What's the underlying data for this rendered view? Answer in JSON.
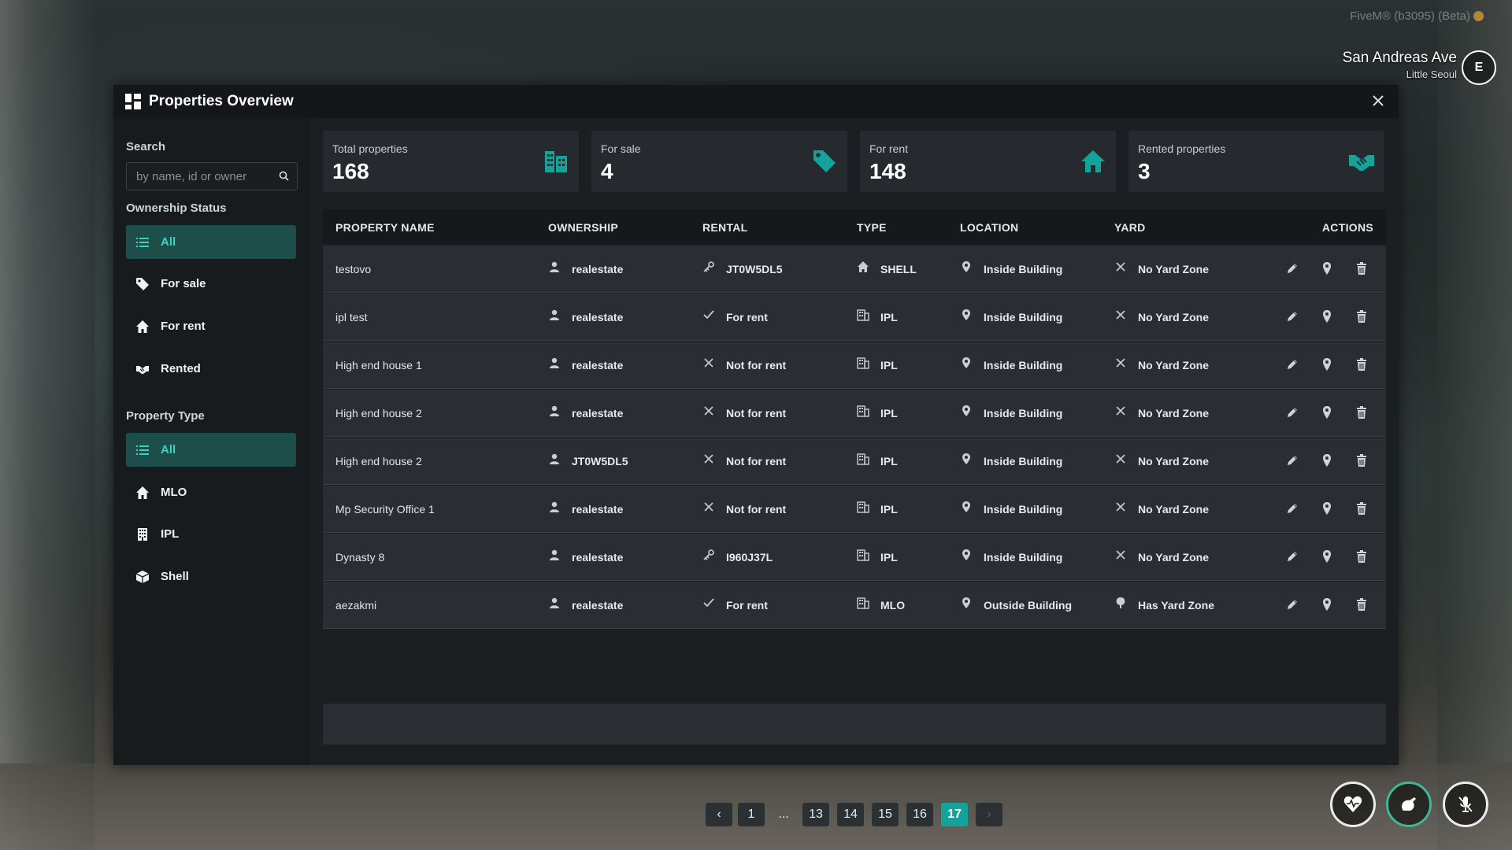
{
  "hud": {
    "fivem_label": "FiveM® (b3095) (Beta)",
    "street_name": "San Andreas Ave",
    "zone_name": "Little Seoul",
    "compass": "E"
  },
  "window": {
    "title": "Properties Overview",
    "close_icon": "close-icon"
  },
  "sidebar": {
    "search_label": "Search",
    "search_placeholder": "by name, id or owner",
    "ownership_label": "Ownership Status",
    "ownership_items": [
      {
        "label": "All",
        "icon": "list-icon",
        "active": true
      },
      {
        "label": "For sale",
        "icon": "tag-icon",
        "active": false
      },
      {
        "label": "For rent",
        "icon": "home-icon",
        "active": false
      },
      {
        "label": "Rented",
        "icon": "handshake-icon",
        "active": false
      }
    ],
    "type_label": "Property Type",
    "type_items": [
      {
        "label": "All",
        "icon": "list-icon",
        "active": true
      },
      {
        "label": "MLO",
        "icon": "home-icon",
        "active": false
      },
      {
        "label": "IPL",
        "icon": "building-icon",
        "active": false
      },
      {
        "label": "Shell",
        "icon": "cube-icon",
        "active": false
      }
    ]
  },
  "stats": [
    {
      "label": "Total properties",
      "value": "168",
      "icon": "building-icon"
    },
    {
      "label": "For sale",
      "value": "4",
      "icon": "tag-icon"
    },
    {
      "label": "For rent",
      "value": "148",
      "icon": "home-icon"
    },
    {
      "label": "Rented properties",
      "value": "3",
      "icon": "handshake-icon"
    }
  ],
  "table": {
    "headers": [
      "PROPERTY NAME",
      "OWNERSHIP",
      "RENTAL",
      "TYPE",
      "LOCATION",
      "YARD",
      "ACTIONS"
    ],
    "rows": [
      {
        "name": "testovo",
        "owner": "realestate",
        "rental": "JT0W5DL5",
        "rental_icon": "key-icon",
        "type": "SHELL",
        "type_icon": "home-icon",
        "location": "Inside Building",
        "yard": "No Yard Zone",
        "yard_icon": "x-icon"
      },
      {
        "name": "ipl test",
        "owner": "realestate",
        "rental": "For rent",
        "rental_icon": "check-icon",
        "type": "IPL",
        "type_icon": "building-icon",
        "location": "Inside Building",
        "yard": "No Yard Zone",
        "yard_icon": "x-icon"
      },
      {
        "name": "High end house 1",
        "owner": "realestate",
        "rental": "Not for rent",
        "rental_icon": "x-icon",
        "type": "IPL",
        "type_icon": "building-icon",
        "location": "Inside Building",
        "yard": "No Yard Zone",
        "yard_icon": "x-icon"
      },
      {
        "name": "High end house 2",
        "owner": "realestate",
        "rental": "Not for rent",
        "rental_icon": "x-icon",
        "type": "IPL",
        "type_icon": "building-icon",
        "location": "Inside Building",
        "yard": "No Yard Zone",
        "yard_icon": "x-icon"
      },
      {
        "name": "High end house 2",
        "owner": "JT0W5DL5",
        "rental": "Not for rent",
        "rental_icon": "x-icon",
        "type": "IPL",
        "type_icon": "building-icon",
        "location": "Inside Building",
        "yard": "No Yard Zone",
        "yard_icon": "x-icon"
      },
      {
        "name": "Mp Security Office 1",
        "owner": "realestate",
        "rental": "Not for rent",
        "rental_icon": "x-icon",
        "type": "IPL",
        "type_icon": "building-icon",
        "location": "Inside Building",
        "yard": "No Yard Zone",
        "yard_icon": "x-icon"
      },
      {
        "name": "Dynasty 8",
        "owner": "realestate",
        "rental": "I960J37L",
        "rental_icon": "key-icon",
        "type": "IPL",
        "type_icon": "building-icon",
        "location": "Inside Building",
        "yard": "No Yard Zone",
        "yard_icon": "x-icon"
      },
      {
        "name": "aezakmi",
        "owner": "realestate",
        "rental": "For rent",
        "rental_icon": "check-icon",
        "type": "MLO",
        "type_icon": "building-icon",
        "location": "Outside Building",
        "yard": "Has Yard Zone",
        "yard_icon": "tree-icon"
      }
    ]
  },
  "pagination": {
    "prev": "‹",
    "pages": [
      "1",
      "...",
      "13",
      "14",
      "15",
      "16",
      "17"
    ],
    "current": "17",
    "next": "›"
  },
  "colors": {
    "accent": "#14a39b",
    "accent_text": "#3fd0c4",
    "active_bg": "#1d4e4a",
    "panel": "#1c1f22",
    "row": "#2a2e32"
  }
}
